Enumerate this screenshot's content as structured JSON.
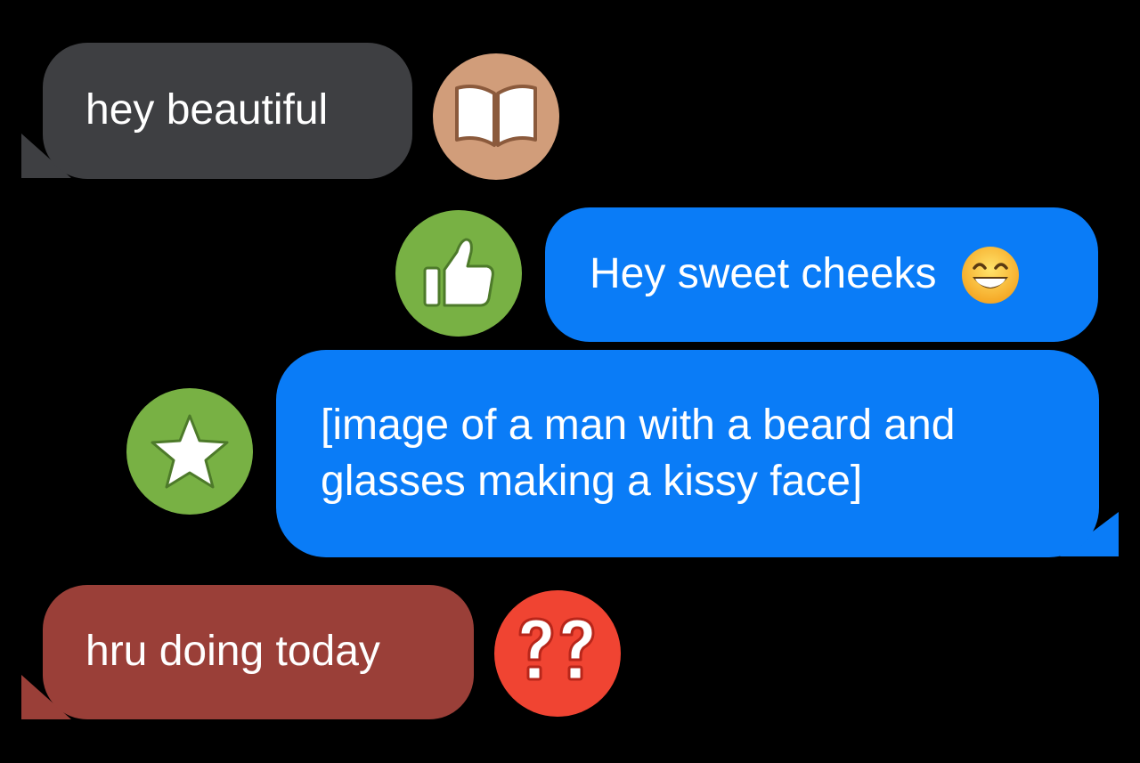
{
  "messages": [
    {
      "text": "hey beautiful",
      "direction": "received",
      "bubble_color": "#3e3f42",
      "reaction": {
        "icon": "open-book-icon",
        "color": "#d19d7a"
      }
    },
    {
      "text": "Hey sweet cheeks",
      "emoji": "grinning-face-with-smiling-eyes-icon",
      "direction": "sent",
      "bubble_color": "#0a7cf7",
      "reaction": {
        "icon": "thumbs-up-icon",
        "color": "#78b144"
      }
    },
    {
      "text": "[image of a man with a beard and\nglasses making a kissy face]",
      "direction": "sent",
      "bubble_color": "#0a7cf7",
      "reaction": {
        "icon": "star-icon",
        "color": "#78b144"
      }
    },
    {
      "text": "hru doing today",
      "direction": "received",
      "bubble_color": "#9a3f38",
      "reaction": {
        "icon": "double-question-mark-icon",
        "color": "#f04432"
      }
    }
  ]
}
